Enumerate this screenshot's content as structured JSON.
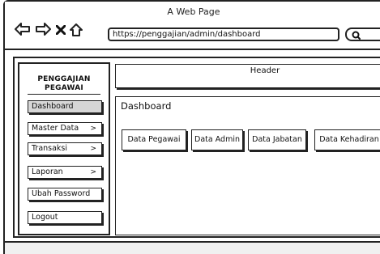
{
  "window": {
    "title": "A Web Page"
  },
  "address_bar": {
    "url": "https://penggajian/admin/dashboard"
  },
  "sidebar": {
    "brand_line1": "PENGGAJIAN",
    "brand_line2": "PEGAWAI",
    "items": [
      {
        "label": "Dashboard",
        "has_submenu": false,
        "active": true
      },
      {
        "label": "Master Data",
        "has_submenu": true,
        "active": false
      },
      {
        "label": "Transaksi",
        "has_submenu": true,
        "active": false
      },
      {
        "label": "Laporan",
        "has_submenu": true,
        "active": false
      },
      {
        "label": "Ubah Password",
        "has_submenu": false,
        "active": false
      },
      {
        "label": "Logout",
        "has_submenu": false,
        "active": false
      }
    ]
  },
  "header": {
    "label": "Header"
  },
  "main": {
    "title": "Dashboard",
    "cards": [
      {
        "label": "Data Pegawai"
      },
      {
        "label": "Data Admin"
      },
      {
        "label": "Data Jabatan"
      },
      {
        "label": "Data Kehadiran"
      }
    ]
  },
  "icons": {
    "back": "arrow-left-icon",
    "forward": "arrow-right-icon",
    "stop": "close-icon",
    "home": "home-icon",
    "search": "search-icon"
  }
}
